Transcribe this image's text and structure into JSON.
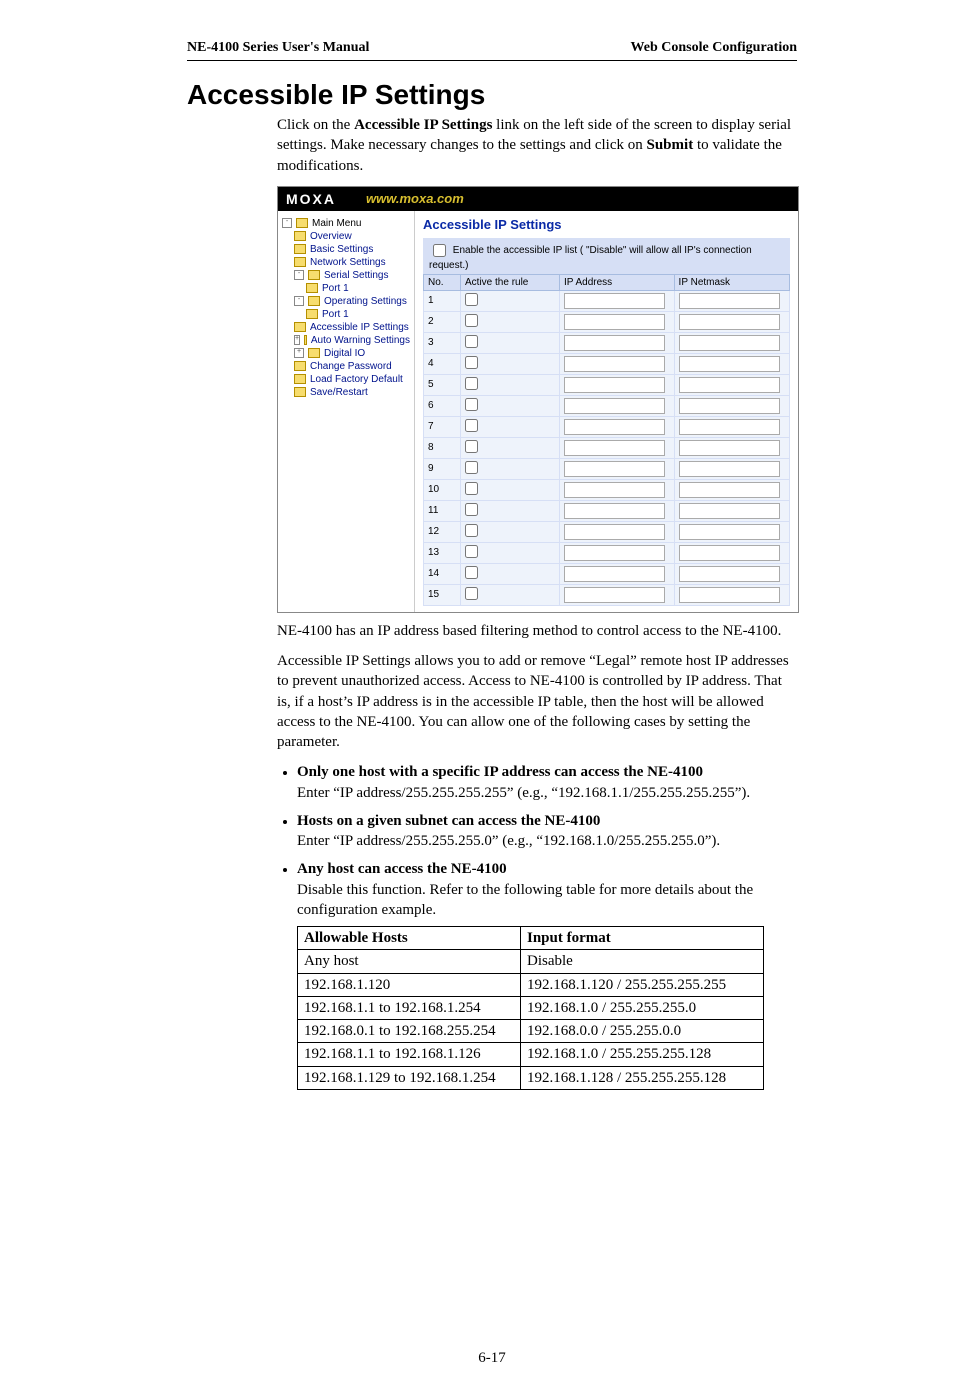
{
  "header": {
    "left": "NE-4100 Series User's Manual",
    "right": "Web Console Configuration"
  },
  "title": "Accessible IP Settings",
  "intro_p1a": "Click on the ",
  "intro_p1b": "Accessible IP Settings",
  "intro_p1c": " link on the left side of the screen to display serial settings. Make necessary changes to the settings and click on ",
  "intro_p1d": "Submit",
  "intro_p1e": " to validate the modifications.",
  "screenshot": {
    "logo": "MOXA",
    "url": "www.moxa.com",
    "nav": {
      "main_menu": "Main Menu",
      "overview": "Overview",
      "basic_settings": "Basic Settings",
      "network_settings": "Network Settings",
      "serial_settings": "Serial Settings",
      "port1a": "Port 1",
      "operating_settings": "Operating Settings",
      "port1b": "Port 1",
      "accessible_ip": "Accessible IP Settings",
      "auto_warning": "Auto Warning Settings",
      "digital_io": "Digital IO",
      "change_password": "Change Password",
      "load_factory": "Load Factory Default",
      "save_restart": "Save/Restart"
    },
    "panel": {
      "title": "Accessible IP Settings",
      "enable_text": "Enable the accessible IP list ( \"Disable\" will allow all IP's connection request.)",
      "cols": {
        "no": "No.",
        "active": "Active the rule",
        "ip": "IP Address",
        "mask": "IP Netmask"
      },
      "rows": 15
    }
  },
  "p2": "NE-4100 has an IP address based filtering method to control access to the NE-4100.",
  "p3": "Accessible IP Settings allows you to add or remove “Legal” remote host IP addresses to prevent unauthorized access. Access to NE-4100 is controlled by IP address. That is, if a host’s IP address is in the accessible IP table, then the host will be allowed access to the NE-4100. You can allow one of the following cases by setting the parameter.",
  "bullets": [
    {
      "head": "Only one host with a specific IP address can access the NE-4100",
      "body": "Enter “IP address/255.255.255.255” (e.g., “192.168.1.1/255.255.255.255”)."
    },
    {
      "head": "Hosts on a given subnet can access the NE-4100",
      "body": "Enter “IP address/255.255.255.0” (e.g., “192.168.1.0/255.255.255.0”)."
    },
    {
      "head": "Any host can access the NE-4100",
      "body": "Disable this function. Refer to the following table for more details about the configuration example."
    }
  ],
  "table": {
    "h1": "Allowable Hosts",
    "h2": "Input format",
    "rows": [
      [
        "Any host",
        "Disable"
      ],
      [
        "192.168.1.120",
        "192.168.1.120 / 255.255.255.255"
      ],
      [
        "192.168.1.1 to 192.168.1.254",
        "192.168.1.0 / 255.255.255.0"
      ],
      [
        "192.168.0.1 to 192.168.255.254",
        "192.168.0.0 / 255.255.0.0"
      ],
      [
        "192.168.1.1 to 192.168.1.126",
        "192.168.1.0 / 255.255.255.128"
      ],
      [
        "192.168.1.129 to 192.168.1.254",
        "192.168.1.128 / 255.255.255.128"
      ]
    ]
  },
  "page_number": "6-17"
}
